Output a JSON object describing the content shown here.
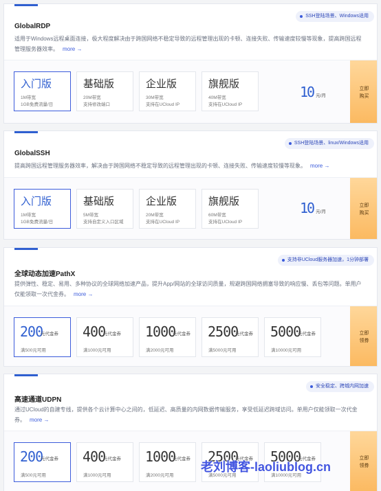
{
  "products": [
    {
      "tag": "SSH登陆场景、Windows适用",
      "title": "GlobalRDP",
      "desc": "适用于Windows远程桌面连接，极大程度解决由于跨国网络不稳定导致的远程管理出现的卡顿、连接失败、传输速度较慢等现象，提高跨国远程管理服务器效率。",
      "more": "more →",
      "plans": [
        {
          "name": "入门版",
          "line1": "1M带宽",
          "line2": "1GB免费流量/日"
        },
        {
          "name": "基础版",
          "line1": "20M带宽",
          "line2": "支持修改端口"
        },
        {
          "name": "企业版",
          "line1": "30M带宽",
          "line2": "支持在UCloud IP"
        },
        {
          "name": "旗舰版",
          "line1": "40M带宽",
          "line2": "支持在UCloud IP"
        }
      ],
      "price": "10",
      "price_unit": "元/月",
      "buy_line1": "立即",
      "buy_line2": "购买"
    },
    {
      "tag": "SSH登陆场景、linux/Windows适用",
      "title": "GlobalSSH",
      "desc": "提高跨国远程管理服务器效率，解决由于跨国网络不稳定导致的远程管理出现的卡顿、连接失败、传输速度较慢等现象。",
      "more": "more →",
      "plans": [
        {
          "name": "入门版",
          "line1": "1M带宽",
          "line2": "1GB免费流量/日"
        },
        {
          "name": "基础版",
          "line1": "5M带宽",
          "line2": "支持自定义入口区域"
        },
        {
          "name": "企业版",
          "line1": "20M带宽",
          "line2": "支持在UCloud IP"
        },
        {
          "name": "旗舰版",
          "line1": "60M带宽",
          "line2": "支持在UCloud IP"
        }
      ],
      "price": "10",
      "price_unit": "元/月",
      "buy_line1": "立即",
      "buy_line2": "购买"
    },
    {
      "tag": "支持非UCloud服务器加速，1分钟部署",
      "title": "全球动态加速PathX",
      "desc": "提供弹性、稳定、易用、多种协议的全球网络加速产品，提升App/网站的全球访问质量，规避跨国网络拥塞导致的响应慢、丢包等问题。单用户仅能领取一次代金券。",
      "more": "more →",
      "coupons": [
        {
          "amount": "200",
          "unit": "元代金券",
          "min": "满500元可用"
        },
        {
          "amount": "400",
          "unit": "元代金券",
          "min": "满1000元可用"
        },
        {
          "amount": "1000",
          "unit": "元代金券",
          "min": "满2000元可用"
        },
        {
          "amount": "2500",
          "unit": "元代金券",
          "min": "满5000元可用"
        },
        {
          "amount": "5000",
          "unit": "元代金券",
          "min": "满10000元可用"
        }
      ],
      "buy_line1": "立即",
      "buy_line2": "领券"
    },
    {
      "tag": "安全稳定、跨城内网加速",
      "title": "高速通道UDPN",
      "desc": "通过UCloud的自建专线，提供各个云计算中心之间的，低延迟、高质量的内网数据传输服务，享受低延迟跨域访问。单用户仅能领取一次代金券。",
      "more": "more →",
      "coupons": [
        {
          "amount": "200",
          "unit": "元代金券",
          "min": "满500元可用"
        },
        {
          "amount": "400",
          "unit": "元代金券",
          "min": "满1000元可用"
        },
        {
          "amount": "1000",
          "unit": "元代金券",
          "min": "满2000元可用"
        },
        {
          "amount": "2500",
          "unit": "元代金券",
          "min": "满5000元可用"
        },
        {
          "amount": "5000",
          "unit": "元代金券",
          "min": "满10000元可用"
        }
      ],
      "buy_line1": "立即",
      "buy_line2": "领券"
    }
  ],
  "watermark": "老刘博客-laoliublog.cn",
  "colors": {
    "accent": "#2f5fd0",
    "button": "#fbb960",
    "tag_bg": "#eef1fb"
  }
}
